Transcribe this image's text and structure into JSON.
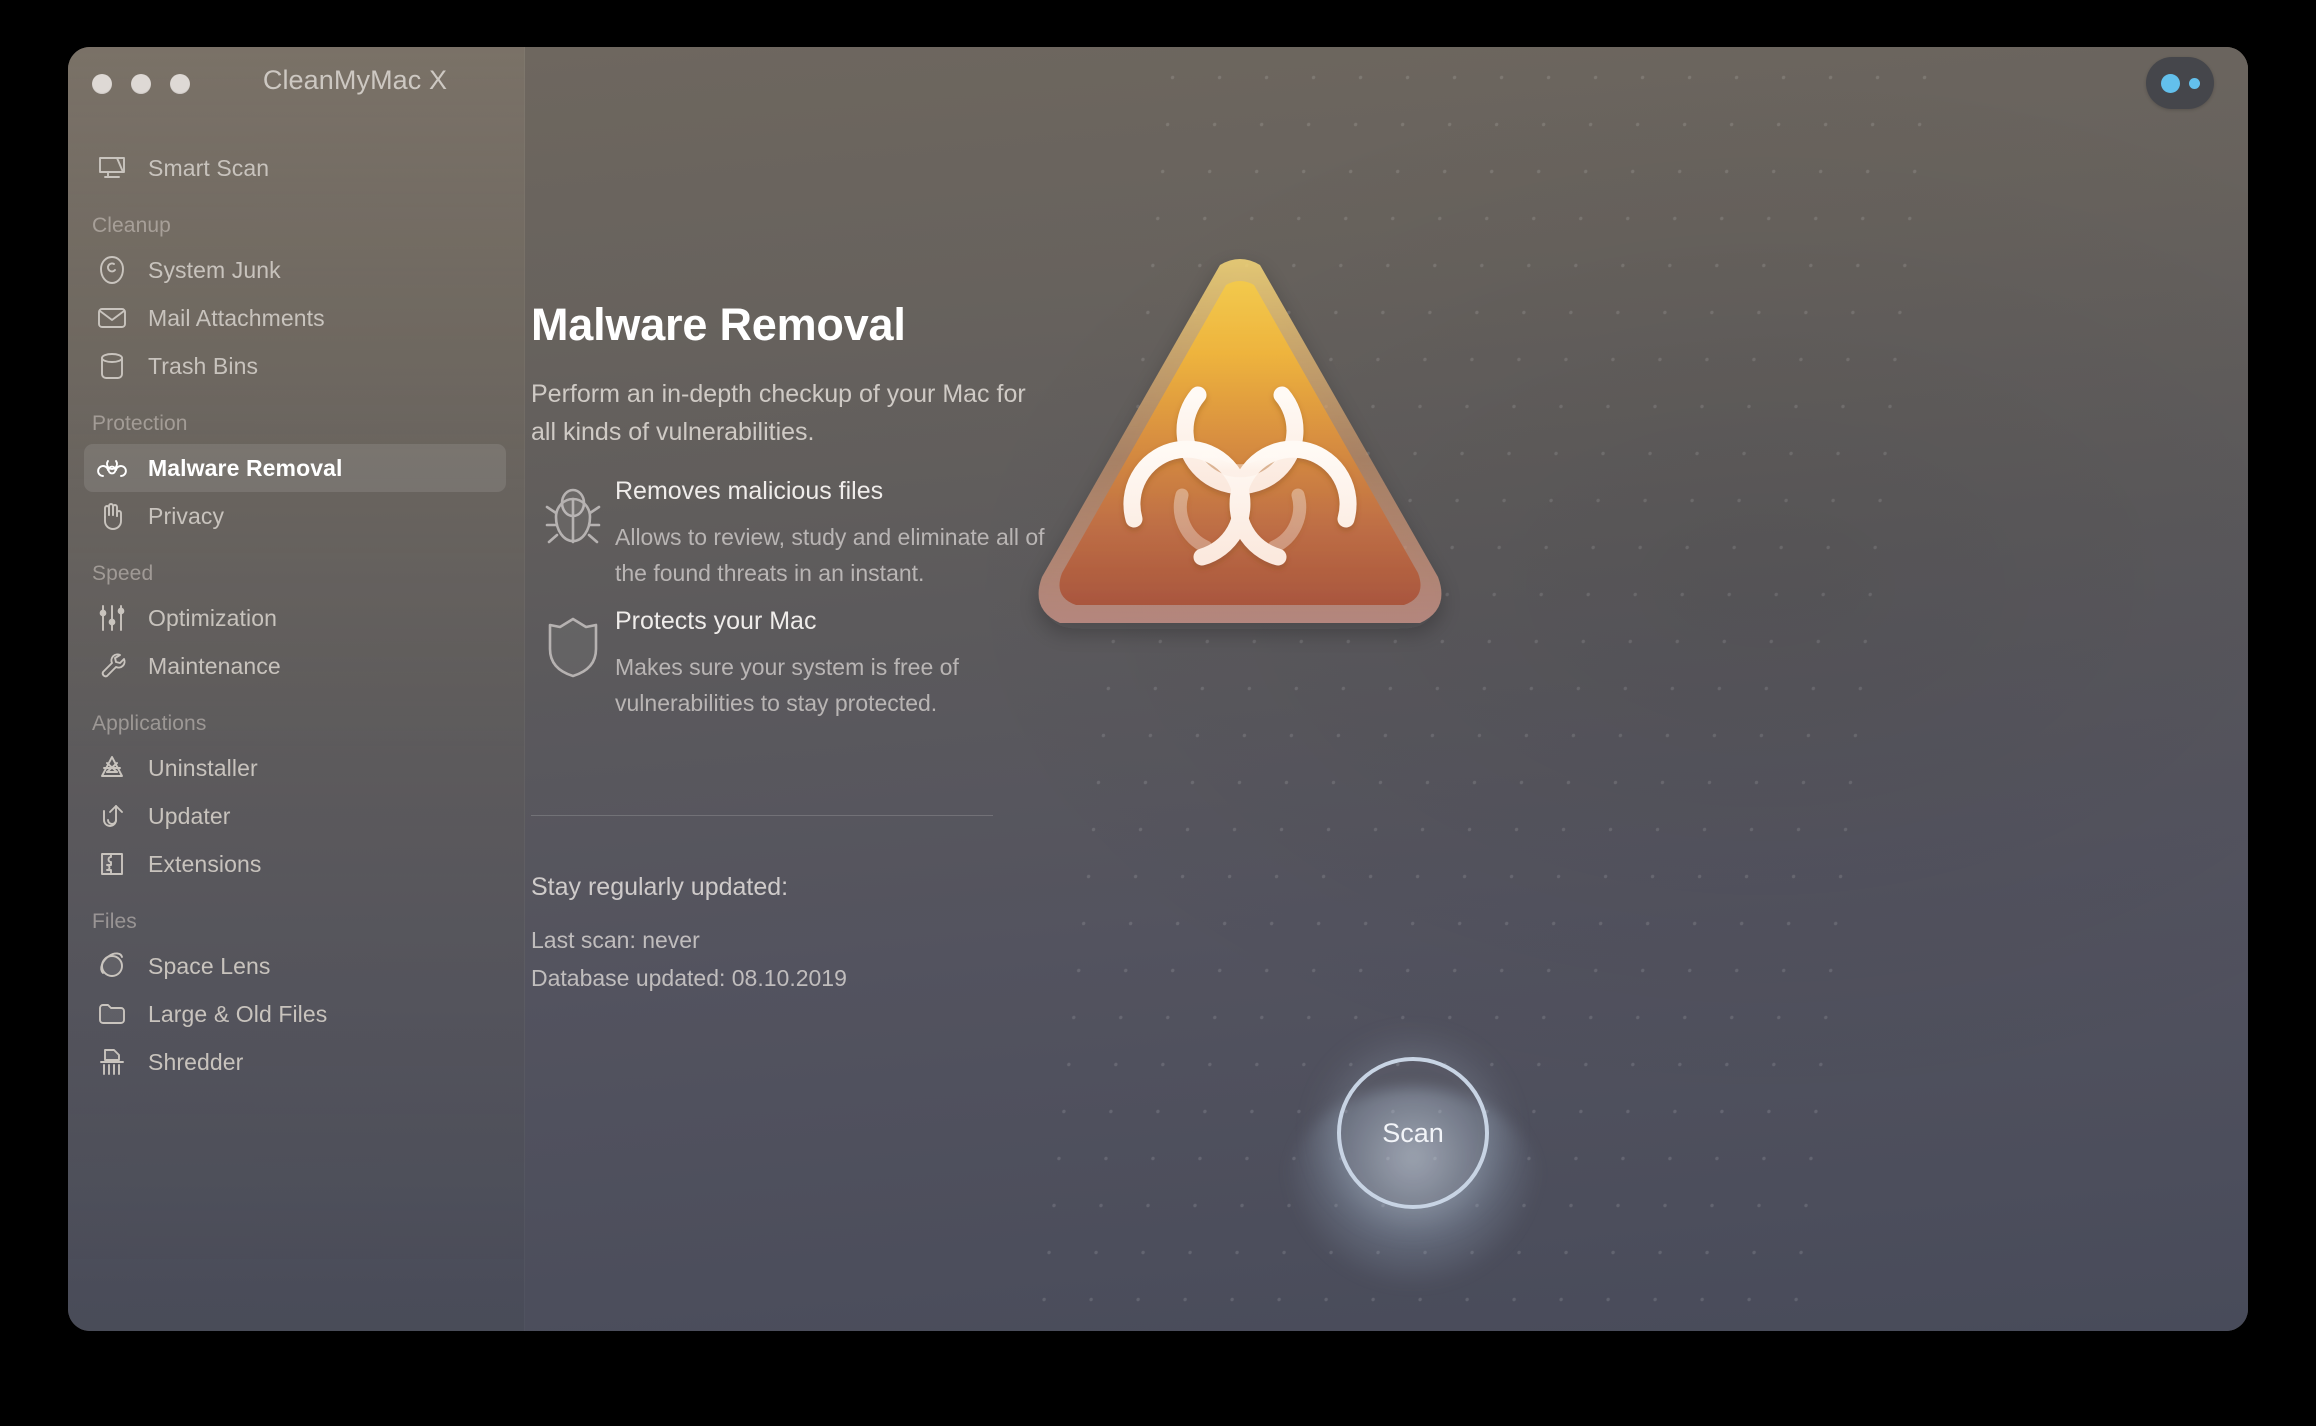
{
  "window": {
    "title": "CleanMyMac X",
    "traffic_lights": [
      "close",
      "minimize",
      "zoom"
    ]
  },
  "notify": {
    "name": "notification-button"
  },
  "sidebar": {
    "groups": [
      {
        "label": "",
        "items": [
          {
            "label": "Smart Scan",
            "icon": "display-icon",
            "active": false
          }
        ]
      },
      {
        "label": "Cleanup",
        "items": [
          {
            "label": "System Junk",
            "icon": "junk-icon",
            "active": false
          },
          {
            "label": "Mail Attachments",
            "icon": "envelope-icon",
            "active": false
          },
          {
            "label": "Trash Bins",
            "icon": "trash-bin-icon",
            "active": false
          }
        ]
      },
      {
        "label": "Protection",
        "items": [
          {
            "label": "Malware Removal",
            "icon": "biohazard-icon",
            "active": true
          },
          {
            "label": "Privacy",
            "icon": "hand-icon",
            "active": false
          }
        ]
      },
      {
        "label": "Speed",
        "items": [
          {
            "label": "Optimization",
            "icon": "sliders-icon",
            "active": false
          },
          {
            "label": "Maintenance",
            "icon": "wrench-icon",
            "active": false
          }
        ]
      },
      {
        "label": "Applications",
        "items": [
          {
            "label": "Uninstaller",
            "icon": "app-stack-icon",
            "active": false
          },
          {
            "label": "Updater",
            "icon": "refresh-up-icon",
            "active": false
          },
          {
            "label": "Extensions",
            "icon": "puzzle-icon",
            "active": false
          }
        ]
      },
      {
        "label": "Files",
        "items": [
          {
            "label": "Space Lens",
            "icon": "planet-icon",
            "active": false
          },
          {
            "label": "Large & Old Files",
            "icon": "folder-icon",
            "active": false
          },
          {
            "label": "Shredder",
            "icon": "shredder-icon",
            "active": false
          }
        ]
      }
    ]
  },
  "main": {
    "title": "Malware Removal",
    "subtitle": "Perform an in-depth checkup of your Mac for all kinds of vulnerabilities.",
    "features": [
      {
        "icon": "bug-icon",
        "title": "Removes malicious files",
        "description": "Allows to review, study and eliminate all of the found threats in an instant."
      },
      {
        "icon": "shield-icon",
        "title": "Protects your Mac",
        "description": "Makes sure your system is free of vulnerabilities to stay protected."
      }
    ],
    "status_heading": "Stay regularly updated:",
    "last_scan": "Last scan: never",
    "database_updated": "Database updated: 08.10.2019",
    "hero_icon": "biohazard-warning-triangle",
    "scan_button_label": "Scan"
  },
  "colors": {
    "accent_blue": "#63c0ec",
    "hero_top": "#f0c040",
    "hero_bottom": "#b05a3c",
    "scan_ring": "#c8d4e4",
    "active_item_bg": "rgba(255,255,255,0.105)"
  }
}
